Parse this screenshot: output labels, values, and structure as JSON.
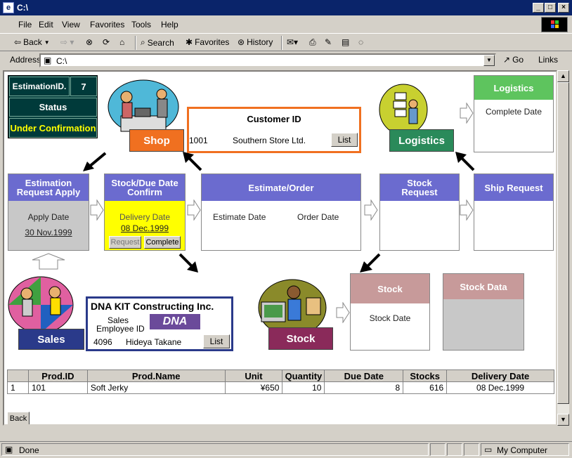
{
  "window": {
    "title": "C:\\"
  },
  "menu": [
    "File",
    "Edit",
    "View",
    "Favorites",
    "Tools",
    "Help"
  ],
  "toolbar": {
    "back": "Back",
    "search": "Search",
    "favorites": "Favorites",
    "history": "History"
  },
  "address": {
    "label": "Address",
    "value": "C:\\",
    "go": "Go",
    "links": "Links"
  },
  "info": {
    "est_label": "EstimationID.",
    "est_value": "7",
    "status_label": "Status",
    "status_value": "Under Confirmation"
  },
  "customer": {
    "title": "Customer  ID",
    "id": "1001",
    "name": "Southern Store Ltd.",
    "list": "List"
  },
  "tags": {
    "shop": "Shop",
    "logistics": "Logistics",
    "sales": "Sales",
    "stock": "Stock"
  },
  "logistics_box": {
    "title": "Logistics",
    "field": "Complete Date"
  },
  "flow": {
    "req_apply": {
      "title": "Estimation Request Apply",
      "label": "Apply Date",
      "value": "30 Nov.1999"
    },
    "stock_due": {
      "title": "Stock/Due Date Confirm",
      "label": "Delivery Date",
      "value": "08 Dec.1999",
      "request": "Request",
      "complete": "Complete"
    },
    "est_order": {
      "title": "Estimate/Order",
      "label1": "Estimate Date",
      "label2": "Order Date"
    },
    "stock_req": {
      "title": "Stock Request"
    },
    "ship_req": {
      "title": "Ship Request"
    }
  },
  "company": {
    "name": "DNA  KIT Constructing Inc.",
    "role1": "Sales",
    "role2": "Employee ID",
    "logo": "DNA",
    "emp_id": "4096",
    "emp_name": "Hideya Takane",
    "list": "List"
  },
  "stock_box": {
    "title": "Stock",
    "field": "Stock Date"
  },
  "stock_data": {
    "title": "Stock Data"
  },
  "table": {
    "headers": [
      "",
      "Prod.ID",
      "Prod.Name",
      "Unit",
      "Quantity",
      "Due Date",
      "Stocks",
      "Delivery Date"
    ],
    "row": [
      "1",
      "101",
      "Soft Jerky",
      "¥650",
      "10",
      "8",
      "616",
      "08 Dec.1999"
    ]
  },
  "back_button": "Back",
  "status": {
    "text": "Done",
    "zone": "My Computer"
  }
}
